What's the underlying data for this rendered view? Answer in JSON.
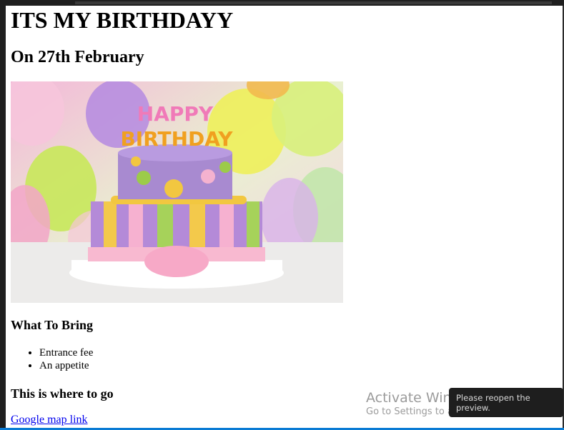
{
  "page": {
    "title": "ITS MY BIRTHDAYY",
    "subtitle": "On 27th February",
    "image_alt": "birthday-cake-image",
    "cake_text": {
      "line1": "HAPPY",
      "line2": "BIRTHDAY"
    },
    "section1_heading": "What To Bring",
    "bring_items": [
      "Entrance fee",
      "An appetite"
    ],
    "section2_heading": "This is where to go",
    "map_link_text": "Google map link"
  },
  "overlay": {
    "watermark_line1": "Activate Windows",
    "watermark_line2": "Go to Settings to activate Windows.",
    "toast_text": "Please reopen the preview."
  },
  "colors": {
    "link": "#0000ee",
    "editor_chrome": "#1f1f1f",
    "status_accent": "#0a7bd4"
  }
}
